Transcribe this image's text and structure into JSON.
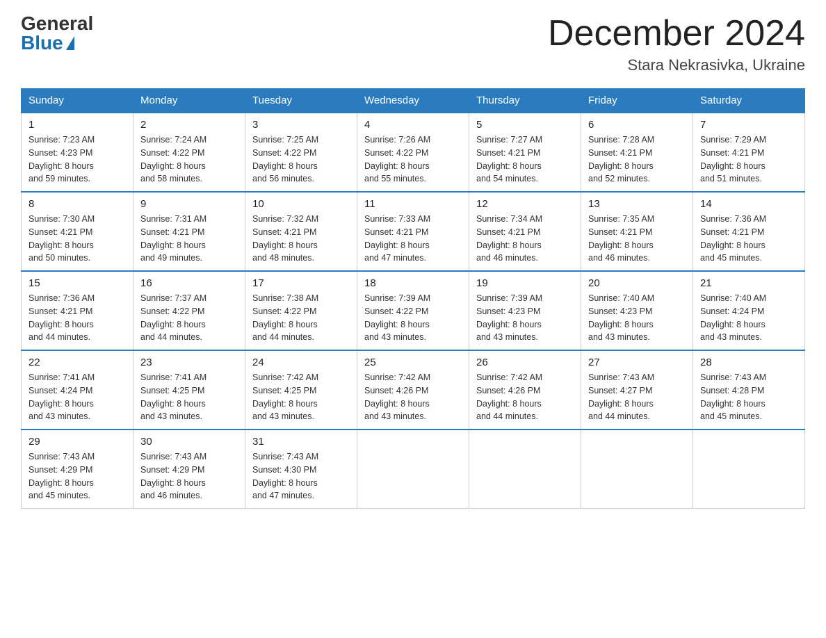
{
  "header": {
    "logo_general": "General",
    "logo_blue": "Blue",
    "month_title": "December 2024",
    "location": "Stara Nekrasivka, Ukraine"
  },
  "days_of_week": [
    "Sunday",
    "Monday",
    "Tuesday",
    "Wednesday",
    "Thursday",
    "Friday",
    "Saturday"
  ],
  "weeks": [
    [
      {
        "day": "1",
        "sunrise": "7:23 AM",
        "sunset": "4:23 PM",
        "daylight": "8 hours and 59 minutes."
      },
      {
        "day": "2",
        "sunrise": "7:24 AM",
        "sunset": "4:22 PM",
        "daylight": "8 hours and 58 minutes."
      },
      {
        "day": "3",
        "sunrise": "7:25 AM",
        "sunset": "4:22 PM",
        "daylight": "8 hours and 56 minutes."
      },
      {
        "day": "4",
        "sunrise": "7:26 AM",
        "sunset": "4:22 PM",
        "daylight": "8 hours and 55 minutes."
      },
      {
        "day": "5",
        "sunrise": "7:27 AM",
        "sunset": "4:21 PM",
        "daylight": "8 hours and 54 minutes."
      },
      {
        "day": "6",
        "sunrise": "7:28 AM",
        "sunset": "4:21 PM",
        "daylight": "8 hours and 52 minutes."
      },
      {
        "day": "7",
        "sunrise": "7:29 AM",
        "sunset": "4:21 PM",
        "daylight": "8 hours and 51 minutes."
      }
    ],
    [
      {
        "day": "8",
        "sunrise": "7:30 AM",
        "sunset": "4:21 PM",
        "daylight": "8 hours and 50 minutes."
      },
      {
        "day": "9",
        "sunrise": "7:31 AM",
        "sunset": "4:21 PM",
        "daylight": "8 hours and 49 minutes."
      },
      {
        "day": "10",
        "sunrise": "7:32 AM",
        "sunset": "4:21 PM",
        "daylight": "8 hours and 48 minutes."
      },
      {
        "day": "11",
        "sunrise": "7:33 AM",
        "sunset": "4:21 PM",
        "daylight": "8 hours and 47 minutes."
      },
      {
        "day": "12",
        "sunrise": "7:34 AM",
        "sunset": "4:21 PM",
        "daylight": "8 hours and 46 minutes."
      },
      {
        "day": "13",
        "sunrise": "7:35 AM",
        "sunset": "4:21 PM",
        "daylight": "8 hours and 46 minutes."
      },
      {
        "day": "14",
        "sunrise": "7:36 AM",
        "sunset": "4:21 PM",
        "daylight": "8 hours and 45 minutes."
      }
    ],
    [
      {
        "day": "15",
        "sunrise": "7:36 AM",
        "sunset": "4:21 PM",
        "daylight": "8 hours and 44 minutes."
      },
      {
        "day": "16",
        "sunrise": "7:37 AM",
        "sunset": "4:22 PM",
        "daylight": "8 hours and 44 minutes."
      },
      {
        "day": "17",
        "sunrise": "7:38 AM",
        "sunset": "4:22 PM",
        "daylight": "8 hours and 44 minutes."
      },
      {
        "day": "18",
        "sunrise": "7:39 AM",
        "sunset": "4:22 PM",
        "daylight": "8 hours and 43 minutes."
      },
      {
        "day": "19",
        "sunrise": "7:39 AM",
        "sunset": "4:23 PM",
        "daylight": "8 hours and 43 minutes."
      },
      {
        "day": "20",
        "sunrise": "7:40 AM",
        "sunset": "4:23 PM",
        "daylight": "8 hours and 43 minutes."
      },
      {
        "day": "21",
        "sunrise": "7:40 AM",
        "sunset": "4:24 PM",
        "daylight": "8 hours and 43 minutes."
      }
    ],
    [
      {
        "day": "22",
        "sunrise": "7:41 AM",
        "sunset": "4:24 PM",
        "daylight": "8 hours and 43 minutes."
      },
      {
        "day": "23",
        "sunrise": "7:41 AM",
        "sunset": "4:25 PM",
        "daylight": "8 hours and 43 minutes."
      },
      {
        "day": "24",
        "sunrise": "7:42 AM",
        "sunset": "4:25 PM",
        "daylight": "8 hours and 43 minutes."
      },
      {
        "day": "25",
        "sunrise": "7:42 AM",
        "sunset": "4:26 PM",
        "daylight": "8 hours and 43 minutes."
      },
      {
        "day": "26",
        "sunrise": "7:42 AM",
        "sunset": "4:26 PM",
        "daylight": "8 hours and 44 minutes."
      },
      {
        "day": "27",
        "sunrise": "7:43 AM",
        "sunset": "4:27 PM",
        "daylight": "8 hours and 44 minutes."
      },
      {
        "day": "28",
        "sunrise": "7:43 AM",
        "sunset": "4:28 PM",
        "daylight": "8 hours and 45 minutes."
      }
    ],
    [
      {
        "day": "29",
        "sunrise": "7:43 AM",
        "sunset": "4:29 PM",
        "daylight": "8 hours and 45 minutes."
      },
      {
        "day": "30",
        "sunrise": "7:43 AM",
        "sunset": "4:29 PM",
        "daylight": "8 hours and 46 minutes."
      },
      {
        "day": "31",
        "sunrise": "7:43 AM",
        "sunset": "4:30 PM",
        "daylight": "8 hours and 47 minutes."
      },
      null,
      null,
      null,
      null
    ]
  ],
  "labels": {
    "sunrise": "Sunrise:",
    "sunset": "Sunset:",
    "daylight": "Daylight:"
  }
}
